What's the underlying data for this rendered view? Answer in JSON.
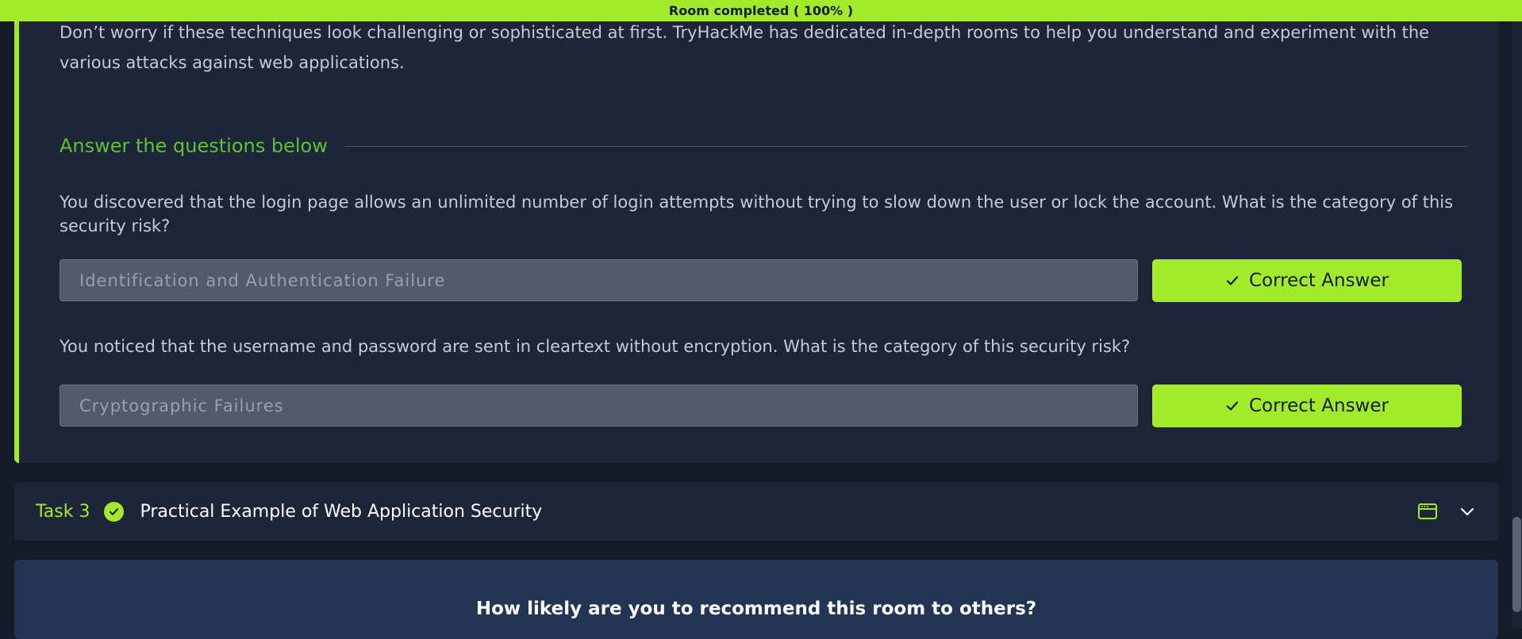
{
  "progress": {
    "label": "Room completed ( 100% )",
    "percent": 100
  },
  "task2": {
    "intro": "Don’t worry if these techniques look challenging or sophisticated at first. TryHackMe has dedicated in-depth rooms to help you understand and experiment with the various attacks against web applications.",
    "answer_heading": "Answer the questions below",
    "questions": [
      {
        "text": "You discovered that the login page allows an unlimited number of login attempts without trying to slow down the user or lock the account. What is the category of this security risk?",
        "answer": "Identification and Authentication Failure",
        "button_label": "Correct Answer"
      },
      {
        "text": "You noticed that the username and password are sent in cleartext without encryption. What is the category of this security risk?",
        "answer": "Cryptographic Failures",
        "button_label": "Correct Answer"
      }
    ]
  },
  "task3": {
    "label": "Task 3",
    "title": "Practical Example of Web Application Security",
    "icons": [
      "check-circle-icon",
      "browser-window-icon",
      "chevron-down-icon"
    ]
  },
  "rating": {
    "question": "How likely are you to recommend this room to others?"
  },
  "colors": {
    "accent": "#a3ea2a",
    "heading_green": "#59c433",
    "card_bg": "#1e2538",
    "page_bg": "#141a26",
    "rating_bg": "#223552"
  }
}
